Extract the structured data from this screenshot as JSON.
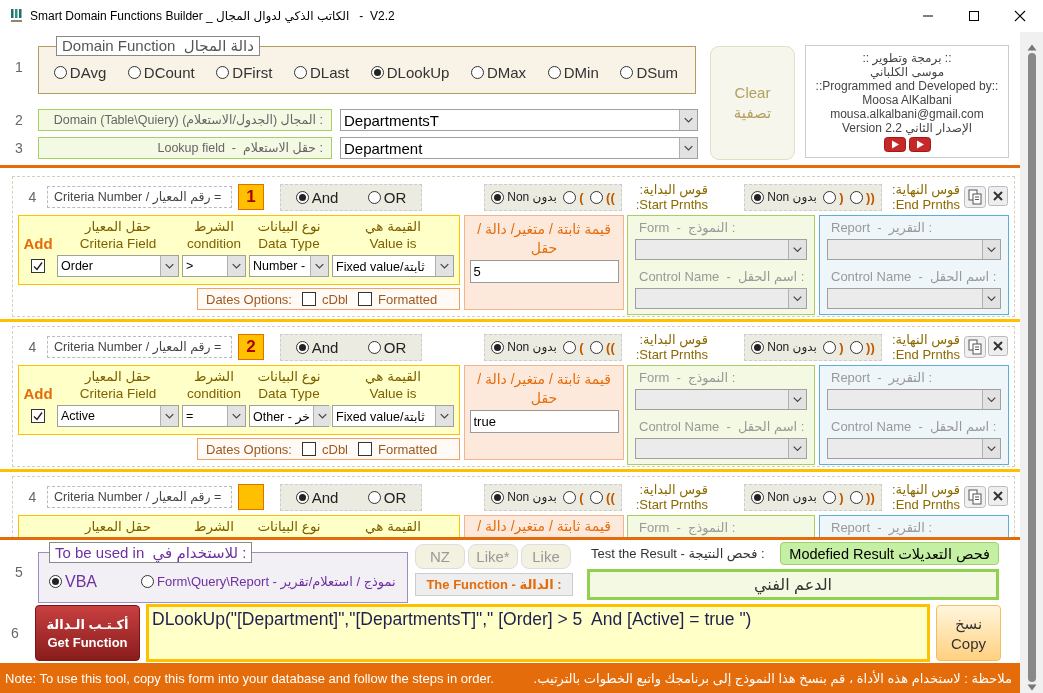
{
  "window": {
    "title": "Smart Domain Functions Builder _ الكاتب الذكي لدوال المجال   -  V2.2"
  },
  "domain_function": {
    "step": "1",
    "legend": "Domain Function  دالة المجال",
    "options": [
      {
        "label": "DSum",
        "selected": false
      },
      {
        "label": "DMin",
        "selected": false
      },
      {
        "label": "DMax",
        "selected": false
      },
      {
        "label": "DLookUp",
        "selected": true
      },
      {
        "label": "DLast",
        "selected": false
      },
      {
        "label": "DFirst",
        "selected": false
      },
      {
        "label": "DCount",
        "selected": false
      },
      {
        "label": "DAvg",
        "selected": false
      }
    ]
  },
  "domain": {
    "step": "2",
    "label": ": المجال (الجدول/الاستعلام) Domain (Table\\Quiery)",
    "value": "DepartmentsT"
  },
  "lookup_field": {
    "step": "3",
    "label": ": حقل الاستعلام  -  Lookup field",
    "value": "Department"
  },
  "clear_button": {
    "en": "Clear",
    "ar": "تصفية"
  },
  "credits": {
    "lines": [
      ":: برمجة وتطوير ::",
      "موسى الكلباني",
      "::Programmed and Developed by::",
      "Moosa AlKalbani",
      "mousa.alkalbani@gmail.com",
      "الإصدار الثاني Version 2.2"
    ]
  },
  "criteria": [
    {
      "step": "4",
      "criteria_label": "Criteria Number / رقم المعيار =",
      "number": "1",
      "logic": [
        {
          "label": "OR",
          "selected": false
        },
        {
          "label": "And",
          "selected": true
        }
      ],
      "start_parens": {
        "label_ar": "قوس البداية:",
        "label_en": "Start Prnths:",
        "options": [
          {
            "label": "((",
            "selected": false
          },
          {
            "label": "(",
            "selected": false
          },
          {
            "label": "Non بدون",
            "selected": true
          }
        ]
      },
      "end_parens": {
        "label_ar": "قوس النهاية:",
        "label_en": "End Prnths:",
        "options": [
          {
            "label": "))",
            "selected": false
          },
          {
            "label": ")",
            "selected": false
          },
          {
            "label": "Non بدون",
            "selected": true
          }
        ]
      },
      "add": {
        "label": "Add",
        "checked": true
      },
      "fields": [
        {
          "ar": "القيمة هي",
          "en": "Value is",
          "value": "Fixed value/ثابتة"
        },
        {
          "ar": "نوع البيانات",
          "en": "Data Type",
          "value": "Number -"
        },
        {
          "ar": "الشرط",
          "en": "condition",
          "value": ">"
        },
        {
          "ar": "حقل المعيار",
          "en": "Criteria Field",
          "value": "Order"
        }
      ],
      "dates": {
        "label": "Dates Options:",
        "options": [
          {
            "label": "Formatted",
            "checked": false
          },
          {
            "label": "cDbl",
            "checked": false
          }
        ]
      },
      "value_heading": "قيمة ثابتة / متغير/ دالة / حقل",
      "value": "5",
      "form": {
        "label": ": النموذج  -  Form",
        "control_label": ": اسم الحقل  -  Control Name"
      },
      "report": {
        "label": ": التقرير  -  Report",
        "control_label": ": اسم الحقل  -  Control Name"
      }
    },
    {
      "step": "4",
      "criteria_label": "Criteria Number / رقم المعيار =",
      "number": "2",
      "logic": [
        {
          "label": "OR",
          "selected": false
        },
        {
          "label": "And",
          "selected": true
        }
      ],
      "start_parens": {
        "label_ar": "قوس البداية:",
        "label_en": "Start Prnths:",
        "options": [
          {
            "label": "((",
            "selected": false
          },
          {
            "label": "(",
            "selected": false
          },
          {
            "label": "Non بدون",
            "selected": true
          }
        ]
      },
      "end_parens": {
        "label_ar": "قوس النهاية:",
        "label_en": "End Prnths:",
        "options": [
          {
            "label": "))",
            "selected": false
          },
          {
            "label": ")",
            "selected": false
          },
          {
            "label": "Non بدون",
            "selected": true
          }
        ]
      },
      "add": {
        "label": "Add",
        "checked": true
      },
      "fields": [
        {
          "ar": "القيمة هي",
          "en": "Value is",
          "value": "Fixed value/ثابتة"
        },
        {
          "ar": "نوع البيانات",
          "en": "Data Type",
          "value": "Other - خر"
        },
        {
          "ar": "الشرط",
          "en": "condition",
          "value": "="
        },
        {
          "ar": "حقل المعيار",
          "en": "Criteria Field",
          "value": "Active"
        }
      ],
      "dates": {
        "label": "Dates Options:",
        "options": [
          {
            "label": "Formatted",
            "checked": false
          },
          {
            "label": "cDbl",
            "checked": false
          }
        ]
      },
      "value_heading": "قيمة ثابتة / متغير/ دالة / حقل",
      "value": "true",
      "form": {
        "label": ": النموذج  -  Form",
        "control_label": ": اسم الحقل  -  Control Name"
      },
      "report": {
        "label": ": التقرير  -  Report",
        "control_label": ": اسم الحقل  -  Control Name"
      }
    },
    {
      "step": "4",
      "criteria_label": "Criteria Number / رقم المعيار =",
      "logic": [
        {
          "label": "OR",
          "selected": false
        },
        {
          "label": "And",
          "selected": true
        }
      ],
      "start_parens": {
        "label_ar": "قوس البداية:",
        "label_en": "Start Prnths:",
        "options": [
          {
            "label": "((",
            "selected": false
          },
          {
            "label": "(",
            "selected": false
          },
          {
            "label": "Non بدون",
            "selected": true
          }
        ]
      },
      "end_parens": {
        "label_ar": "قوس النهاية:",
        "label_en": "End Prnths:",
        "options": [
          {
            "label": "))",
            "selected": false
          },
          {
            "label": ")",
            "selected": false
          },
          {
            "label": "Non بدون",
            "selected": true
          }
        ]
      },
      "fields": [
        {
          "ar": "القيمة هي"
        },
        {
          "ar": "نوع البيانات"
        },
        {
          "ar": "الشرط"
        },
        {
          "ar": "حقل المعيار"
        }
      ],
      "value_heading": "قيمة ثابتة / متغير/ دالة /",
      "form": {
        "label": ": النموذج  -  Form"
      },
      "report": {
        "label": ": التقرير  -  Report"
      }
    }
  ],
  "usage": {
    "step": "5",
    "legend": "To be used in  للاستخدام في :",
    "options": [
      {
        "label": "Form\\Query\\Report - نموذج / استعلام/تقرير",
        "selected": false
      },
      {
        "label": "VBA",
        "selected": true
      }
    ]
  },
  "helper_buttons": [
    "Like",
    "Like*",
    "NZ"
  ],
  "function_label": "The Function - الدالة :",
  "test": {
    "label": "Test the Result - فحص النتيجة :",
    "button": "Modefied Result فحص التعديلات",
    "result": "الدعم الفني"
  },
  "output": {
    "step": "6",
    "get_button": {
      "ar": "أكـتـب الـدالة",
      "en": "Get Function"
    },
    "text": "DLookUp(\"[Department]\",\"[DepartmentsT]\",\" [Order] > 5  And [Active] = true \")",
    "copy_button": {
      "ar": "نسخ",
      "en": "Copy"
    }
  },
  "note": {
    "en": "Note: To use this tool, copy this form into your database and follow the steps in order.",
    "ar": "ملاحظة : لاستخدام هذه الأداة ، قم بنسخ هذا النموذج إلى برنامجك واتبع الخطوات بالترتيب."
  }
}
